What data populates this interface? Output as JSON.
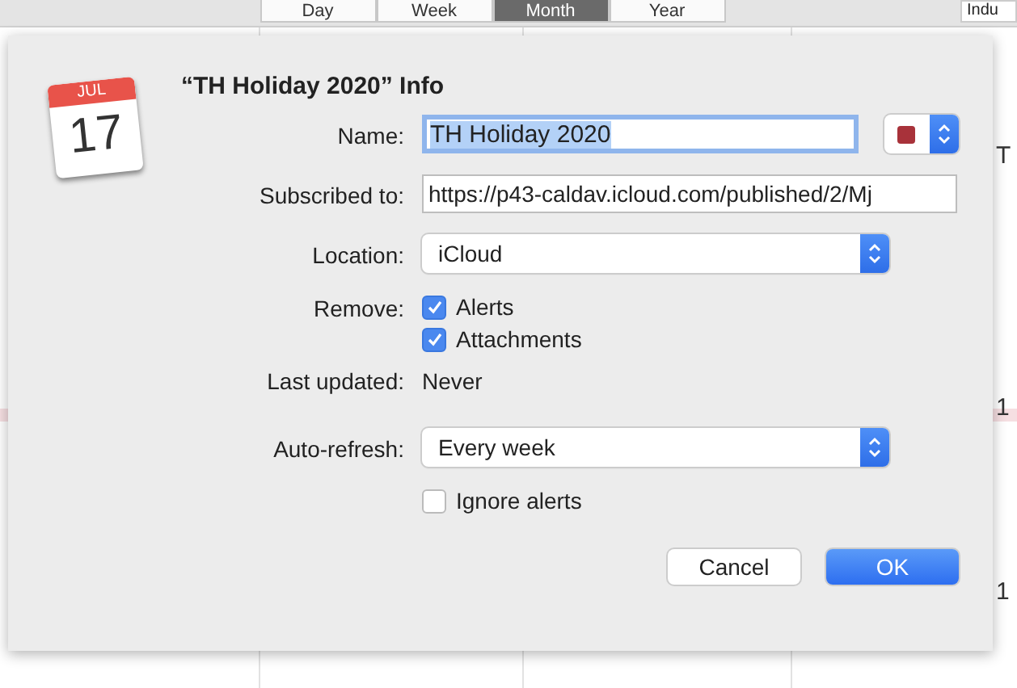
{
  "view_switcher": [
    {
      "label": "Day",
      "selected": false
    },
    {
      "label": "Week",
      "selected": false
    },
    {
      "label": "Month",
      "selected": true
    },
    {
      "label": "Year",
      "selected": false
    }
  ],
  "search_field": {
    "value": "Indu"
  },
  "background_texts": [
    "T",
    "1",
    "1"
  ],
  "dialog": {
    "icon": {
      "month": "JUL",
      "day": "17"
    },
    "title": "“TH Holiday 2020” Info",
    "rows": [
      {
        "kind": "text",
        "label": "Name:",
        "value": "TH Holiday 2020",
        "focused": true,
        "color": "#a8323a"
      },
      {
        "kind": "text",
        "label": "Subscribed to:",
        "value": "https://p43-caldav.icloud.com/published/2/Mj",
        "focused": false
      },
      {
        "kind": "popup",
        "label": "Location:",
        "value": "iCloud"
      },
      {
        "kind": "checks",
        "label": "Remove:",
        "options": [
          {
            "label": "Alerts",
            "checked": true
          },
          {
            "label": "Attachments",
            "checked": true
          }
        ]
      },
      {
        "kind": "static",
        "label": "Last updated:",
        "value": "Never"
      },
      {
        "kind": "popup",
        "label": "Auto-refresh:",
        "value": "Every week"
      },
      {
        "kind": "checks",
        "options": [
          {
            "label": "Ignore alerts",
            "checked": false
          }
        ]
      }
    ],
    "buttons": [
      {
        "label": "Cancel",
        "default": false
      },
      {
        "label": "OK",
        "default": true
      }
    ]
  }
}
